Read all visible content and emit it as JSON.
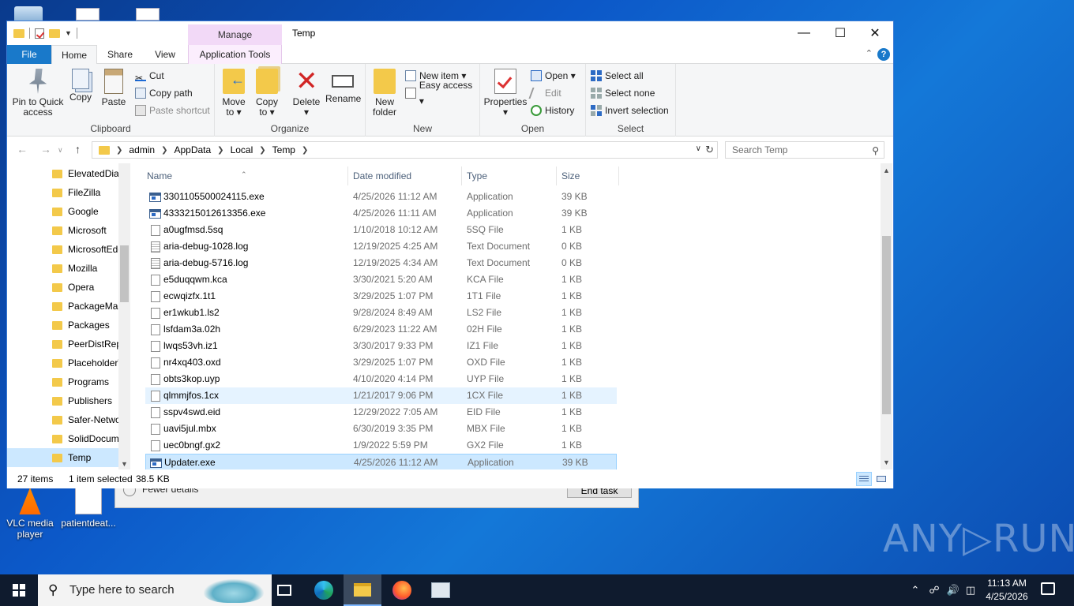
{
  "desktop": {
    "icons": [
      {
        "label": "VLC media player"
      },
      {
        "label": "patientdeat..."
      }
    ],
    "watermark": "ANY▷RUN"
  },
  "taskmgr": {
    "fewer_details": "Fewer details",
    "end_task": "End task"
  },
  "window": {
    "title": "Temp",
    "manage_label": "Manage",
    "controls": {
      "minimize": "—",
      "maximize": "☐",
      "close": "✕"
    }
  },
  "ribbon": {
    "tabs": {
      "file": "File",
      "home": "Home",
      "share": "Share",
      "view": "View",
      "app_tools": "Application Tools"
    },
    "clipboard": {
      "label": "Clipboard",
      "pin": [
        "Pin to Quick",
        "access"
      ],
      "copy": "Copy",
      "paste": "Paste",
      "cut": "Cut",
      "copy_path": "Copy path",
      "paste_shortcut": "Paste shortcut"
    },
    "organize": {
      "label": "Organize",
      "move_to": [
        "Move",
        "to ▾"
      ],
      "copy_to": [
        "Copy",
        "to ▾"
      ],
      "delete": [
        "Delete",
        "▾"
      ],
      "rename": "Rename"
    },
    "new": {
      "label": "New",
      "new_folder": [
        "New",
        "folder"
      ],
      "new_item": "New item ▾",
      "easy_access": "Easy access ▾"
    },
    "open": {
      "label": "Open",
      "properties": [
        "Properties",
        "▾"
      ],
      "open": "Open ▾",
      "edit": "Edit",
      "history": "History"
    },
    "select": {
      "label": "Select",
      "select_all": "Select all",
      "select_none": "Select none",
      "invert": "Invert selection"
    }
  },
  "address": {
    "crumbs": [
      "admin",
      "AppData",
      "Local",
      "Temp"
    ],
    "search_placeholder": "Search Temp"
  },
  "nav_items": [
    "ElevatedDiagnostics",
    "FileZilla",
    "Google",
    "Microsoft",
    "MicrosoftEdge",
    "Mozilla",
    "Opera",
    "PackageManagement",
    "Packages",
    "PeerDistRepub",
    "PlaceholderTileLogoFolder",
    "Programs",
    "Publishers",
    "Safer-Networking",
    "SolidDocuments",
    "Temp"
  ],
  "columns": {
    "name": "Name",
    "date": "Date modified",
    "type": "Type",
    "size": "Size"
  },
  "files": [
    {
      "name": "3301105500024115.exe",
      "date": "4/25/2026 11:12 AM",
      "type": "Application",
      "size": "39 KB",
      "icon": "app"
    },
    {
      "name": "4333215012613356.exe",
      "date": "4/25/2026 11:11 AM",
      "type": "Application",
      "size": "39 KB",
      "icon": "app"
    },
    {
      "name": "a0ugfmsd.5sq",
      "date": "1/10/2018 10:12 AM",
      "type": "5SQ File",
      "size": "1 KB",
      "icon": "file"
    },
    {
      "name": "aria-debug-1028.log",
      "date": "12/19/2025 4:25 AM",
      "type": "Text Document",
      "size": "0 KB",
      "icon": "txt"
    },
    {
      "name": "aria-debug-5716.log",
      "date": "12/19/2025 4:34 AM",
      "type": "Text Document",
      "size": "0 KB",
      "icon": "txt"
    },
    {
      "name": "e5duqqwm.kca",
      "date": "3/30/2021 5:20 AM",
      "type": "KCA File",
      "size": "1 KB",
      "icon": "file"
    },
    {
      "name": "ecwqizfx.1t1",
      "date": "3/29/2025 1:07 PM",
      "type": "1T1 File",
      "size": "1 KB",
      "icon": "file"
    },
    {
      "name": "er1wkub1.ls2",
      "date": "9/28/2024 8:49 AM",
      "type": "LS2 File",
      "size": "1 KB",
      "icon": "file"
    },
    {
      "name": "lsfdam3a.02h",
      "date": "6/29/2023 11:22 AM",
      "type": "02H File",
      "size": "1 KB",
      "icon": "file"
    },
    {
      "name": "lwqs53vh.iz1",
      "date": "3/30/2017 9:33 PM",
      "type": "IZ1 File",
      "size": "1 KB",
      "icon": "file"
    },
    {
      "name": "nr4xq403.oxd",
      "date": "3/29/2025 1:07 PM",
      "type": "OXD File",
      "size": "1 KB",
      "icon": "file"
    },
    {
      "name": "obts3kop.uyp",
      "date": "4/10/2020 4:14 PM",
      "type": "UYP File",
      "size": "1 KB",
      "icon": "file"
    },
    {
      "name": "qlmmjfos.1cx",
      "date": "1/21/2017 9:06 PM",
      "type": "1CX File",
      "size": "1 KB",
      "icon": "file"
    },
    {
      "name": "sspv4swd.eid",
      "date": "12/29/2022 7:05 AM",
      "type": "EID File",
      "size": "1 KB",
      "icon": "file"
    },
    {
      "name": "uavi5jul.mbx",
      "date": "6/30/2019 3:35 PM",
      "type": "MBX File",
      "size": "1 KB",
      "icon": "file"
    },
    {
      "name": "uec0bngf.gx2",
      "date": "1/9/2022 5:59 PM",
      "type": "GX2 File",
      "size": "1 KB",
      "icon": "file"
    },
    {
      "name": "Updater.exe",
      "date": "4/25/2026 11:12 AM",
      "type": "Application",
      "size": "39 KB",
      "icon": "app"
    }
  ],
  "status": {
    "items": "27 items",
    "selected": "1 item selected",
    "selected_size": "38.5 KB"
  },
  "taskbar": {
    "search_text": "Type here to search",
    "time": "11:13 AM",
    "date": "4/25/2026"
  }
}
